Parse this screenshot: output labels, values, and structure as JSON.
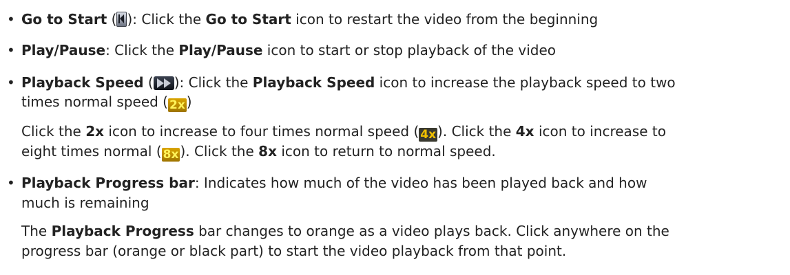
{
  "bullet_glyph": "•",
  "items": {
    "go_to_start": {
      "term": "Go to Start",
      "open_paren": " (",
      "close_paren_colon": "): Click the ",
      "term_repeat": "Go to Start",
      "rest": " icon to restart the video from the beginning"
    },
    "play_pause": {
      "term": "Play/Pause",
      "mid": ": Click the ",
      "term_repeat": "Play/Pause",
      "rest": " icon to start or stop playback of the video"
    },
    "playback_speed": {
      "term": "Playback Speed",
      "open_paren": " (",
      "close_paren_colon": "): Click the ",
      "term_repeat": "Playback Speed",
      "rest": " icon to increase the playback speed to two",
      "line2_text": "times normal speed (",
      "line2_close": ")",
      "speed_2x": "2x",
      "note_line1_a": "Click the ",
      "note_line1_b": "2x",
      "note_line1_c": " icon to increase to four times normal speed (",
      "speed_4x": "4x",
      "note_line1_d": "). Click the ",
      "note_line1_e": "4x",
      "note_line1_f": " icon to increase to",
      "note_line2_a": "eight times normal (",
      "speed_8x": "8x",
      "note_line2_b": "). Click the ",
      "note_line2_c": "8x",
      "note_line2_d": " icon to return to normal speed."
    },
    "progress_bar": {
      "term": "Playback Progress bar",
      "rest": ": Indicates how much of the video has been played back and how",
      "line2_text": "much is remaining",
      "note_line1_a": "The ",
      "note_line1_b": "Playback Progress",
      "note_line1_c": " bar changes to orange as a video plays back. Click anywhere on the",
      "note_line2": "progress bar (orange or black part) to start the video playback from that point."
    }
  },
  "icons": {
    "go_to_start": "go-to-start-icon",
    "fast_forward": "fast-forward-icon"
  }
}
